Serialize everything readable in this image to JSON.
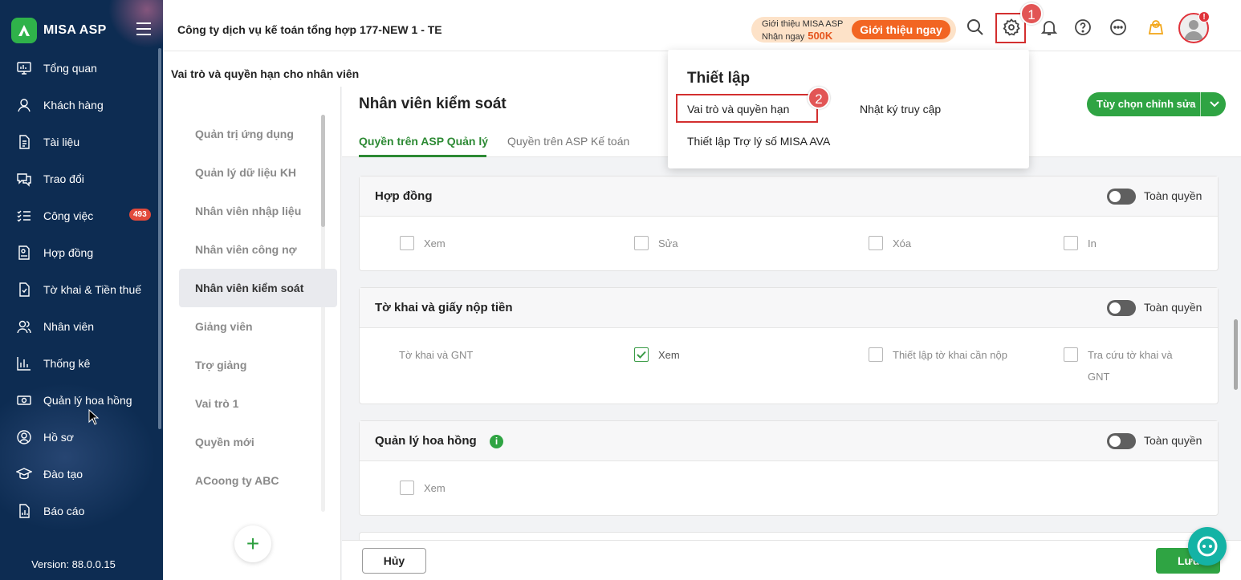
{
  "brand": {
    "name": "MISA ASP",
    "logo_color": "#2fb24a"
  },
  "sidebar": {
    "items": [
      {
        "label": "Tổng quan",
        "icon": "monitor-icon"
      },
      {
        "label": "Khách hàng",
        "icon": "user-icon"
      },
      {
        "label": "Tài liệu",
        "icon": "document-icon"
      },
      {
        "label": "Trao đổi",
        "icon": "chat-icon"
      },
      {
        "label": "Công việc",
        "icon": "tasks-icon",
        "badge": "493"
      },
      {
        "label": "Hợp đồng",
        "icon": "contract-icon"
      },
      {
        "label": "Tờ khai & Tiền thuế",
        "icon": "tax-form-icon"
      },
      {
        "label": "Nhân viên",
        "icon": "staff-icon"
      },
      {
        "label": "Thống kê",
        "icon": "chart-icon"
      },
      {
        "label": "Quản lý hoa hồng",
        "icon": "money-icon"
      },
      {
        "label": "Hồ sơ",
        "icon": "profile-icon"
      },
      {
        "label": "Đào tạo",
        "icon": "graduation-icon"
      },
      {
        "label": "Báo cáo",
        "icon": "report-icon"
      }
    ],
    "version": "Version: 88.0.0.15"
  },
  "header": {
    "company": "Công ty dịch vụ kế toán tổng hợp 177-NEW 1 - TE",
    "promo": {
      "line1": "Giới thiệu MISA ASP",
      "line2": "Nhận ngay",
      "amount": "500K",
      "button": "Giới thiệu ngay"
    },
    "avatar_alert": "!"
  },
  "steps": {
    "one": "1",
    "two": "2"
  },
  "page_title": "Vai trò và quyền hạn cho nhân viên",
  "roles": [
    {
      "label": "Quản trị ứng dụng",
      "active": false
    },
    {
      "label": "Quản lý dữ liệu KH",
      "active": false
    },
    {
      "label": "Nhân viên nhập liệu",
      "active": false
    },
    {
      "label": "Nhân viên công nợ",
      "active": false
    },
    {
      "label": "Nhân viên kiểm soát",
      "active": true
    },
    {
      "label": "Giảng viên",
      "active": false
    },
    {
      "label": "Trợ giảng",
      "active": false
    },
    {
      "label": "Vai trò 1",
      "active": false
    },
    {
      "label": "Quyền mới",
      "active": false
    },
    {
      "label": "ACoong ty ABC",
      "active": false
    }
  ],
  "main": {
    "title": "Nhân viên kiểm soát",
    "tabs": [
      "Quyền trên ASP Quản lý",
      "Quyền trên ASP Kế toán"
    ],
    "edit_button": "Tùy chọn chỉnh sửa",
    "full_permission": "Toàn quyền",
    "sections": [
      {
        "title": "Hợp đồng",
        "perms": [
          {
            "label": "Xem",
            "checked": false
          },
          {
            "label": "Sửa",
            "checked": false
          },
          {
            "label": "Xóa",
            "checked": false
          },
          {
            "label": "In",
            "checked": false
          }
        ]
      },
      {
        "title": "Tờ khai và giấy nộp tiền",
        "group_label": "Tờ khai và GNT",
        "perms": [
          {
            "label": "Xem",
            "checked": true
          },
          {
            "label": "Thiết lập tờ khai cần nộp",
            "checked": false
          },
          {
            "label": "Tra cứu tờ khai và",
            "label2": "GNT",
            "checked": false
          }
        ]
      },
      {
        "title": "Quản lý hoa hồng",
        "info": "i",
        "perms": [
          {
            "label": "Xem",
            "checked": false
          }
        ]
      }
    ]
  },
  "footer": {
    "cancel": "Hủy",
    "save": "Lưu"
  },
  "dropdown": {
    "title": "Thiết lập",
    "items": [
      "Vai trò và quyền hạn",
      "Nhật ký truy cập",
      "Thiết lập Trợ lý số MISA AVA"
    ]
  },
  "colors": {
    "sidebar_bg": "#0d2c52",
    "accent": "#2fa443",
    "promo_orange": "#f26522",
    "highlight_red": "#d32f2f"
  }
}
